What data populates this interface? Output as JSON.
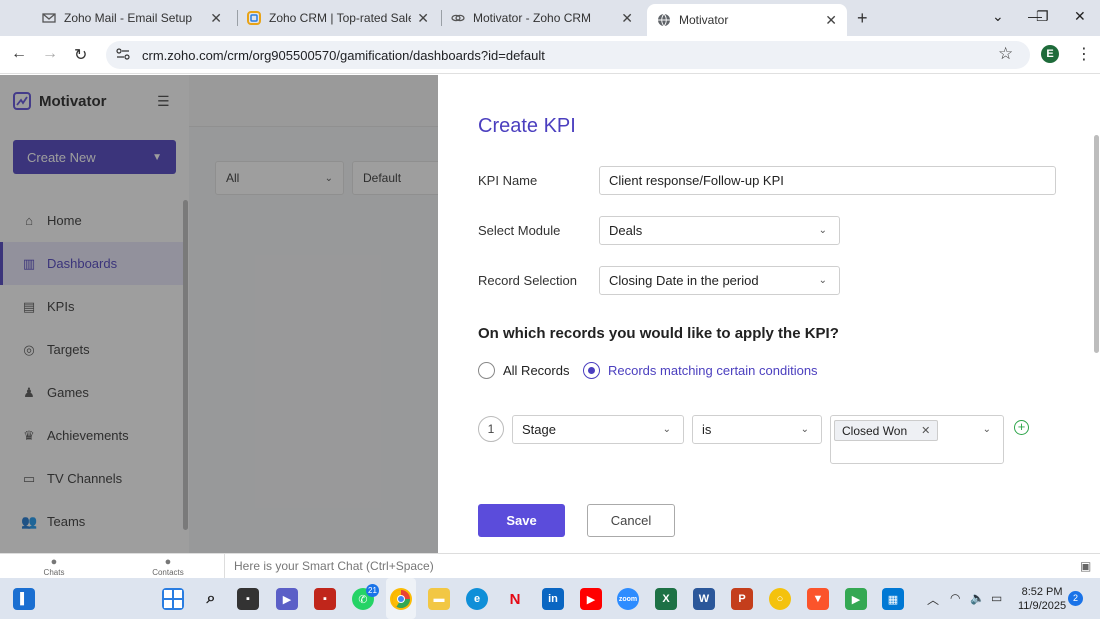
{
  "browser": {
    "tabs": [
      {
        "title": "Zoho Mail - Email Setup",
        "icon": "zoho-mail-icon"
      },
      {
        "title": "Zoho CRM | Top-rated Sales CR",
        "icon": "zoho-crm-icon"
      },
      {
        "title": "Motivator - Zoho CRM",
        "icon": "link-icon"
      },
      {
        "title": "Motivator",
        "icon": "globe-icon"
      }
    ],
    "url": "crm.zoho.com/crm/org905500570/gamification/dashboards?id=default",
    "profile_initial": "E"
  },
  "sidebar": {
    "app_name": "Motivator",
    "create_new": "Create New",
    "items": [
      {
        "label": "Home",
        "icon": "home-icon"
      },
      {
        "label": "Dashboards",
        "icon": "dashboard-icon"
      },
      {
        "label": "KPIs",
        "icon": "kpi-icon"
      },
      {
        "label": "Targets",
        "icon": "target-icon"
      },
      {
        "label": "Games",
        "icon": "games-icon"
      },
      {
        "label": "Achievements",
        "icon": "trophy-icon"
      },
      {
        "label": "TV Channels",
        "icon": "tv-icon"
      },
      {
        "label": "Teams",
        "icon": "teams-icon"
      }
    ],
    "active": "Dashboards"
  },
  "main": {
    "filter_all": "All",
    "filter_default": "Default"
  },
  "kpi_form": {
    "title": "Create KPI",
    "kpi_name_label": "KPI Name",
    "kpi_name_value": "Client response/Follow-up KPI",
    "module_label": "Select Module",
    "module_value": "Deals",
    "record_selection_label": "Record Selection",
    "record_selection_value": "Closing Date in the period",
    "question": "On which records you would like to apply the KPI?",
    "radio_all": "All Records",
    "radio_matching": "Records matching certain conditions",
    "selected_radio": "Records matching certain conditions",
    "condition": {
      "number": "1",
      "field": "Stage",
      "operator": "is",
      "values": [
        "Closed Won"
      ]
    },
    "save": "Save",
    "cancel": "Cancel"
  },
  "smartbar": {
    "chats": "Chats",
    "contacts": "Contacts",
    "placeholder": "Here is your Smart Chat (Ctrl+Space)"
  },
  "taskbar": {
    "whatsapp_badge": "21",
    "time": "8:52 PM",
    "date": "11/9/2025",
    "notifications": "2"
  }
}
